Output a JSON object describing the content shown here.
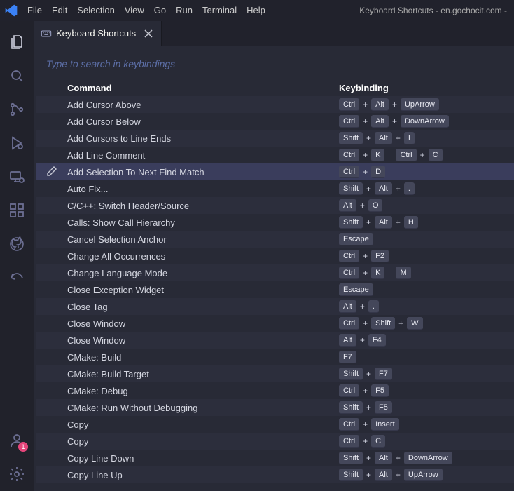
{
  "titlebar": {
    "menu": [
      "File",
      "Edit",
      "Selection",
      "View",
      "Go",
      "Run",
      "Terminal",
      "Help"
    ],
    "window_title": "Keyboard Shortcuts - en.gochocit.com -"
  },
  "tab": {
    "title": "Keyboard Shortcuts"
  },
  "search": {
    "placeholder": "Type to search in keybindings"
  },
  "columns": {
    "command": "Command",
    "keybinding": "Keybinding"
  },
  "account_badge": "1",
  "selectedIndex": 4,
  "rows": [
    {
      "command": "Add Cursor Above",
      "keys": [
        [
          "Ctrl",
          "Alt",
          "UpArrow"
        ]
      ]
    },
    {
      "command": "Add Cursor Below",
      "keys": [
        [
          "Ctrl",
          "Alt",
          "DownArrow"
        ]
      ]
    },
    {
      "command": "Add Cursors to Line Ends",
      "keys": [
        [
          "Shift",
          "Alt",
          "I"
        ]
      ]
    },
    {
      "command": "Add Line Comment",
      "keys": [
        [
          "Ctrl",
          "K"
        ],
        [
          "Ctrl",
          "C"
        ]
      ]
    },
    {
      "command": "Add Selection To Next Find Match",
      "keys": [
        [
          "Ctrl",
          "D"
        ]
      ]
    },
    {
      "command": "Auto Fix...",
      "keys": [
        [
          "Shift",
          "Alt",
          "."
        ]
      ]
    },
    {
      "command": "C/C++: Switch Header/Source",
      "keys": [
        [
          "Alt",
          "O"
        ]
      ]
    },
    {
      "command": "Calls: Show Call Hierarchy",
      "keys": [
        [
          "Shift",
          "Alt",
          "H"
        ]
      ]
    },
    {
      "command": "Cancel Selection Anchor",
      "keys": [
        [
          "Escape"
        ]
      ]
    },
    {
      "command": "Change All Occurrences",
      "keys": [
        [
          "Ctrl",
          "F2"
        ]
      ]
    },
    {
      "command": "Change Language Mode",
      "keys": [
        [
          "Ctrl",
          "K"
        ],
        [
          "M"
        ]
      ]
    },
    {
      "command": "Close Exception Widget",
      "keys": [
        [
          "Escape"
        ]
      ]
    },
    {
      "command": "Close Tag",
      "keys": [
        [
          "Alt",
          "."
        ]
      ]
    },
    {
      "command": "Close Window",
      "keys": [
        [
          "Ctrl",
          "Shift",
          "W"
        ]
      ]
    },
    {
      "command": "Close Window",
      "keys": [
        [
          "Alt",
          "F4"
        ]
      ]
    },
    {
      "command": "CMake: Build",
      "keys": [
        [
          "F7"
        ]
      ]
    },
    {
      "command": "CMake: Build Target",
      "keys": [
        [
          "Shift",
          "F7"
        ]
      ]
    },
    {
      "command": "CMake: Debug",
      "keys": [
        [
          "Ctrl",
          "F5"
        ]
      ]
    },
    {
      "command": "CMake: Run Without Debugging",
      "keys": [
        [
          "Shift",
          "F5"
        ]
      ]
    },
    {
      "command": "Copy",
      "keys": [
        [
          "Ctrl",
          "Insert"
        ]
      ]
    },
    {
      "command": "Copy",
      "keys": [
        [
          "Ctrl",
          "C"
        ]
      ]
    },
    {
      "command": "Copy Line Down",
      "keys": [
        [
          "Shift",
          "Alt",
          "DownArrow"
        ]
      ]
    },
    {
      "command": "Copy Line Up",
      "keys": [
        [
          "Shift",
          "Alt",
          "UpArrow"
        ]
      ]
    }
  ]
}
